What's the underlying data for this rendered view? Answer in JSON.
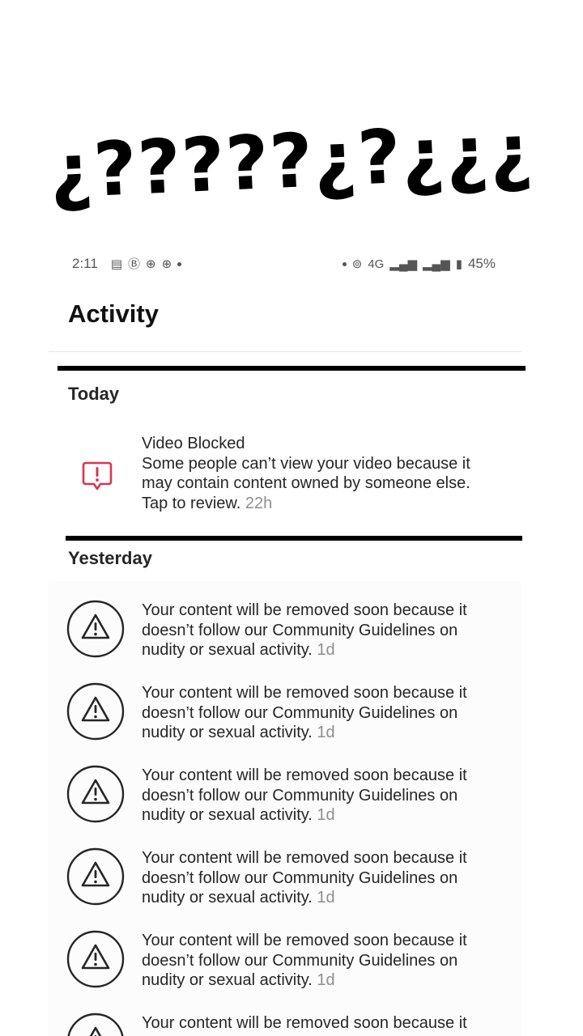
{
  "caption": "¿?????¿?¿¿¿",
  "status_bar": {
    "time": "2:11",
    "network": "4G",
    "battery": "45%"
  },
  "header": {
    "title": "Activity"
  },
  "sections": {
    "today": {
      "label": "Today",
      "items": [
        {
          "title": "Video Blocked",
          "body": "Some people can’t view your video because it may contain content owned by someone else. Tap to review.",
          "time": "22h"
        }
      ]
    },
    "yesterday": {
      "label": "Yesterday",
      "items": [
        {
          "body": "Your content will be removed soon because it doesn’t follow our Community Guidelines on nudity or sexual activity.",
          "time": "1d"
        },
        {
          "body": "Your content will be removed soon because it doesn’t follow our Community Guidelines on nudity or sexual activity.",
          "time": "1d"
        },
        {
          "body": "Your content will be removed soon because it doesn’t follow our Community Guidelines on nudity or sexual activity.",
          "time": "1d"
        },
        {
          "body": "Your content will be removed soon because it doesn’t follow our Community Guidelines on nudity or sexual activity.",
          "time": "1d"
        },
        {
          "body": "Your content will be removed soon because it doesn’t follow our Community Guidelines on nudity or sexual activity.",
          "time": "1d"
        },
        {
          "body": "Your content will be removed soon because it doesn’t follow our Community Guidelines on nudity or sexual activity.",
          "time": ""
        }
      ]
    }
  },
  "colors": {
    "blocked_icon": "#d9364b",
    "text": "#262626",
    "time": "#8e8e8e"
  }
}
